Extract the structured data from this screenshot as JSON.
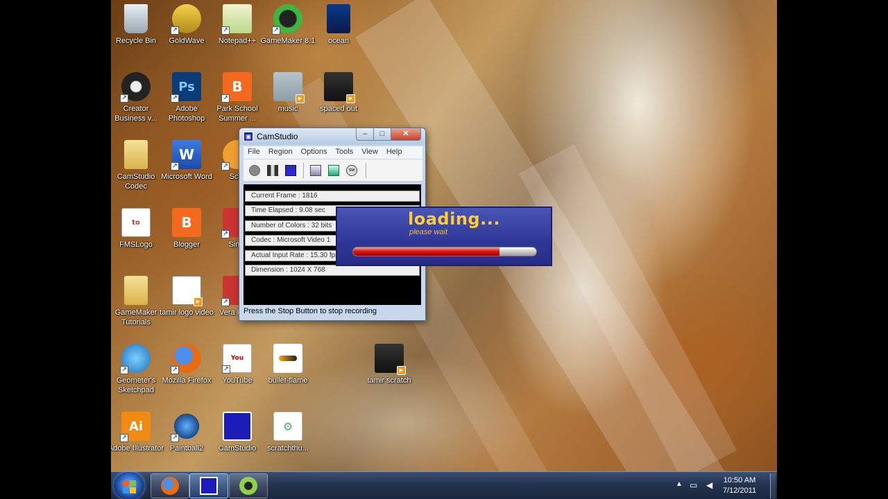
{
  "desktop": {
    "icons": [
      {
        "label": "Recycle Bin",
        "icon": "recycle-bin-icon"
      },
      {
        "label": "GoldWave",
        "icon": "goldwave-icon"
      },
      {
        "label": "Notepad++",
        "icon": "notepad-plus-plus-icon"
      },
      {
        "label": "GameMaker 8.1",
        "icon": "gamemaker-icon"
      },
      {
        "label": "ocean",
        "icon": "image-file-icon"
      },
      {
        "label": "Creator Business v...",
        "icon": "creator-icon"
      },
      {
        "label": "Adobe Photoshop",
        "icon": "photoshop-icon"
      },
      {
        "label": "Park School Summer ...",
        "icon": "blogger-icon"
      },
      {
        "label": "music",
        "icon": "video-file-icon"
      },
      {
        "label": "spaced out",
        "icon": "video-file-icon"
      },
      {
        "label": "CamStudio Codec",
        "icon": "folder-icon"
      },
      {
        "label": "Microsoft Word",
        "icon": "word-icon"
      },
      {
        "label": "Scra",
        "icon": "scratch-icon"
      },
      {
        "label": "FMSLogo",
        "icon": "fmslogo-icon"
      },
      {
        "label": "Blogger",
        "icon": "blogger-icon"
      },
      {
        "label": "Simu",
        "icon": "app-icon"
      },
      {
        "label": "GameMaker Tutorials",
        "icon": "folder-icon"
      },
      {
        "label": "tamir logo video",
        "icon": "video-file-icon"
      },
      {
        "label": "Vera Porta",
        "icon": "app-icon"
      },
      {
        "label": "Geometer's Sketchpad",
        "icon": "sketchpad-icon"
      },
      {
        "label": "Mozilla Firefox",
        "icon": "firefox-icon"
      },
      {
        "label": "YouTube",
        "icon": "youtube-icon"
      },
      {
        "label": "bullet-flame",
        "icon": "image-file-icon"
      },
      {
        "label": "tamir scratch",
        "icon": "video-file-icon"
      },
      {
        "label": "Adobe Illustrator",
        "icon": "illustrator-icon"
      },
      {
        "label": "Paintball2",
        "icon": "paintball-icon"
      },
      {
        "label": "CamStudio",
        "icon": "camstudio-icon"
      },
      {
        "label": "scratchthu...",
        "icon": "settings-file-icon"
      }
    ]
  },
  "camstudio": {
    "title": "CamStudio",
    "menu": [
      "File",
      "Region",
      "Options",
      "Tools",
      "View",
      "Help"
    ],
    "info": [
      "Current Frame : 1816",
      "Time Elapsed : 9.08 sec",
      "Number of Colors : 32 bits",
      "Codec : Microsoft Video 1",
      "Actual Input Rate : 15.30 fps",
      "Dimension : 1024 X 768"
    ],
    "status": "Press the Stop Button to stop recording"
  },
  "loading": {
    "title": "loading...",
    "subtitle": "please wait",
    "progress": 0.8
  },
  "taskbar": {
    "time": "10:50 AM",
    "date": "7/12/2011"
  },
  "colors": {
    "accent_loading": "#ffcc33",
    "progress_fill": "#e01818",
    "taskbar": "#22314d"
  }
}
